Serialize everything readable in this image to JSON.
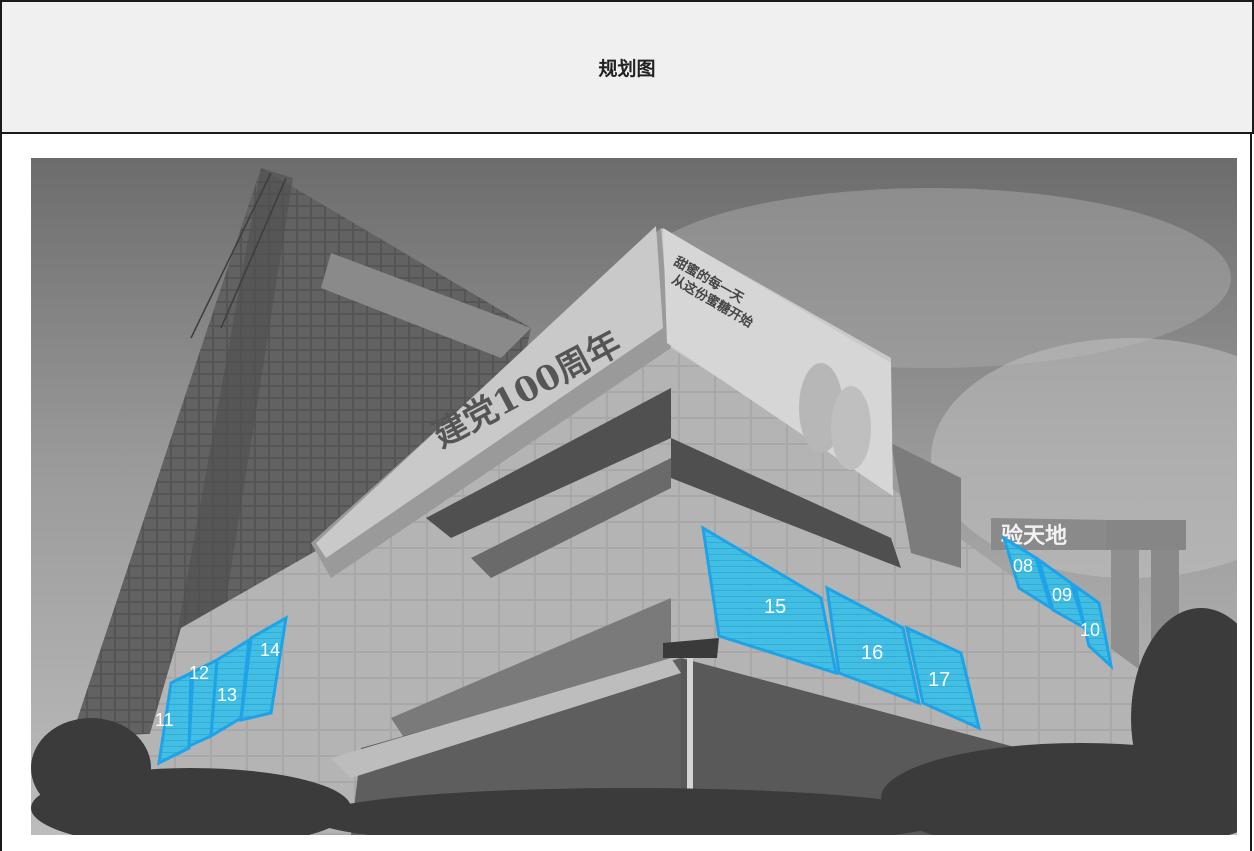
{
  "header": {
    "title": "规划图"
  },
  "photo": {
    "billboard_text": "建党100周年",
    "top_ad_text_1": "甜蜜的每一天",
    "top_ad_text_2": "从这份蜜糖开始",
    "far_sign_text": "验天地",
    "screens": [
      {
        "id": "08"
      },
      {
        "id": "09"
      },
      {
        "id": "10"
      },
      {
        "id": "11"
      },
      {
        "id": "12"
      },
      {
        "id": "13"
      },
      {
        "id": "14"
      },
      {
        "id": "15"
      },
      {
        "id": "16"
      },
      {
        "id": "17"
      }
    ],
    "highlight_color": "#33bde6",
    "highlight_border": "#1fa3e8"
  }
}
